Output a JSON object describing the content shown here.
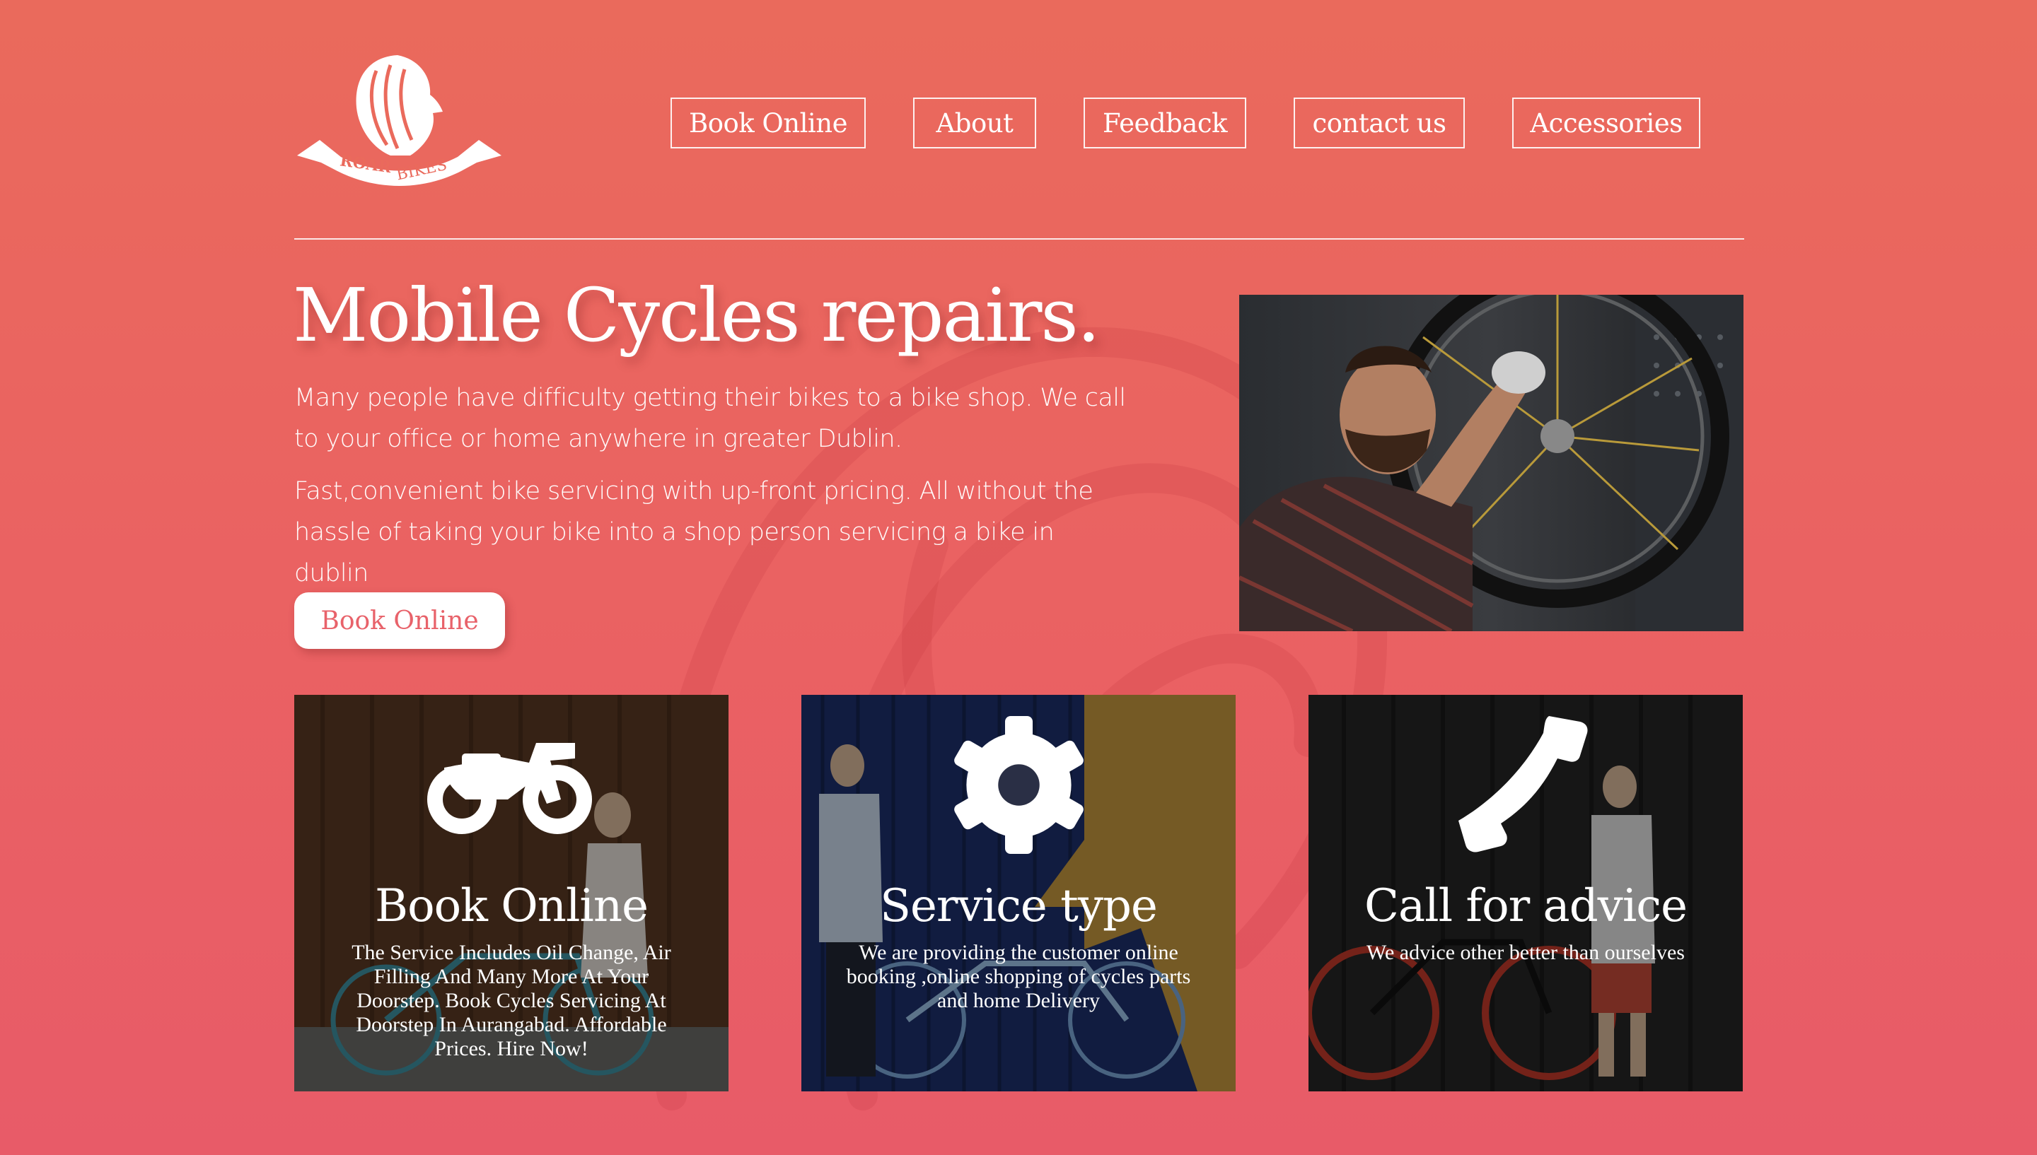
{
  "brand": {
    "logo_text_1": "ROAR",
    "logo_text_2": "BIKES"
  },
  "nav": {
    "items": [
      {
        "label": "Book Online"
      },
      {
        "label": "About"
      },
      {
        "label": "Feedback"
      },
      {
        "label": "contact us"
      },
      {
        "label": "Accessories"
      }
    ]
  },
  "hero": {
    "title": "Mobile Cycles repairs.",
    "paragraph_1": "Many people have difficulty getting their bikes to a bike shop. We call to your office or home anywhere in greater Dublin.",
    "paragraph_2": "Fast,convenient bike servicing with up-front pricing. All without the hassle of taking your bike into a shop person servicing a bike in dublin",
    "button_label": "Book Online"
  },
  "cards": [
    {
      "icon": "motorcycle-icon",
      "title": "Book Online",
      "text": "The Service Includes Oil Change, Air Filling And Many More At Your Doorstep. Book Cycles Servicing At Doorstep In Aurangabad. Affordable Prices. Hire Now!"
    },
    {
      "icon": "gear-icon",
      "title": "Service type",
      "text": "We are providing the customer online booking ,online shopping of cycles parts and home Delivery"
    },
    {
      "icon": "phone-icon",
      "title": "Call for advice",
      "text": "We advice other better than ourselves"
    }
  ],
  "colors": {
    "background": "#ea6464",
    "button_text": "#e8626a",
    "card_overlay": "#000000"
  }
}
